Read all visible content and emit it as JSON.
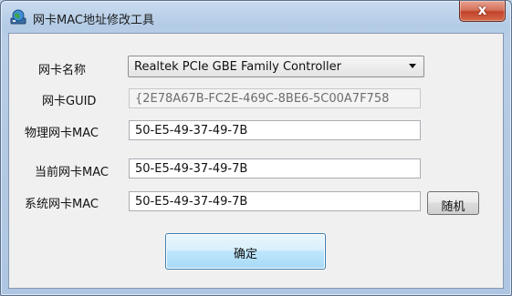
{
  "window": {
    "title": "网卡MAC地址修改工具",
    "close_glyph": "x"
  },
  "form": {
    "adapter_name_label": "网卡名称",
    "adapter_name_value": "Realtek PCIe GBE Family Controller",
    "guid_label": "网卡GUID",
    "guid_value": "{2E78A67B-FC2E-469C-8BE6-5C00A7F758",
    "physical_mac_label": "物理网卡MAC",
    "physical_mac_value": "50-E5-49-37-49-7B",
    "current_mac_label": "当前网卡MAC",
    "current_mac_value": "50-E5-49-37-49-7B",
    "system_mac_label": "系统网卡MAC",
    "system_mac_value": "50-E5-49-37-49-7B",
    "random_button": "随机",
    "ok_button": "确定"
  },
  "colors": {
    "title_gradient_top": "#c9dbee",
    "close_red": "#c1432b",
    "default_button_border": "#3c7fb1"
  },
  "icons": {
    "app": "network-globe-icon",
    "close": "close-icon",
    "dropdown": "chevron-down-icon"
  }
}
